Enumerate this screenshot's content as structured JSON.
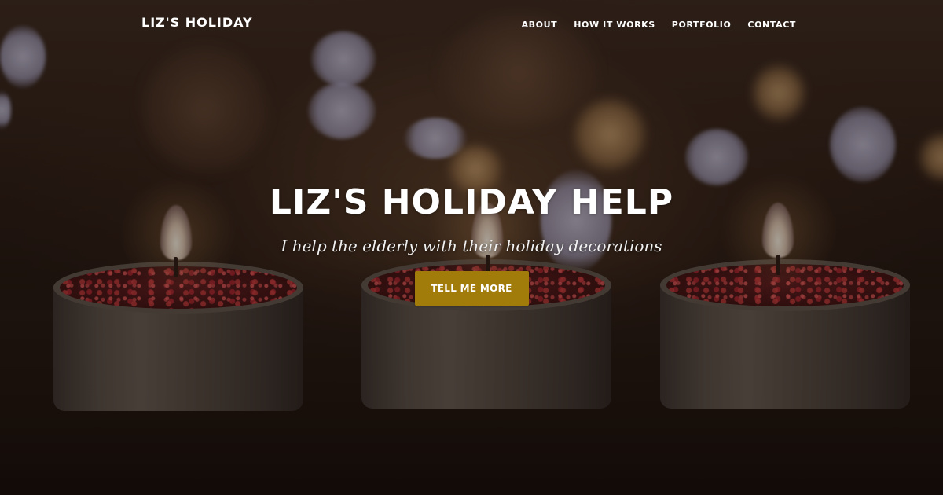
{
  "navbar": {
    "brand": "LIZ'S HOLIDAY",
    "links": [
      {
        "label": "ABOUT"
      },
      {
        "label": "HOW IT WORKS"
      },
      {
        "label": "PORTFOLIO"
      },
      {
        "label": "CONTACT"
      }
    ]
  },
  "hero": {
    "title": "LIZ'S HOLIDAY HELP",
    "subtitle": "I help the elderly with their holiday decorations",
    "cta_label": "TELL ME MORE",
    "background_image": "three lit tealight candles with red wax on a wooden table, bokeh lights in background"
  },
  "colors": {
    "accent": "#a27c0a",
    "text": "#ffffff",
    "background": "#1e140e"
  }
}
